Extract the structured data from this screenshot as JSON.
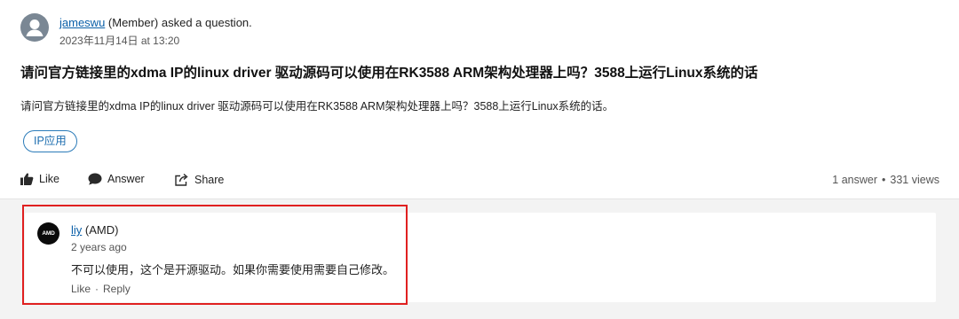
{
  "question": {
    "author": {
      "name": "jameswu",
      "suffix": " (Member) asked a question.",
      "timestamp": "2023年11月14日 at 13:20",
      "avatar_icon": "user-icon"
    },
    "title": "请问官方链接里的xdma IP的linux driver 驱动源码可以使用在RK3588 ARM架构处理器上吗？3588上运行Linux系统的话",
    "body": "请问官方链接里的xdma IP的linux driver 驱动源码可以使用在RK3588 ARM架构处理器上吗？3588上运行Linux系统的话。",
    "tag": "IP应用",
    "actions": {
      "like": "Like",
      "answer": "Answer",
      "share": "Share"
    },
    "stats": {
      "answers": "1 answer",
      "separator": "•",
      "views": "331 views"
    }
  },
  "answer": {
    "author_name": "liy",
    "author_suffix": " (AMD)",
    "avatar_text": "AMD",
    "time": "2 years ago",
    "text": "不可以使用，这个是开源驱动。如果你需要使用需要自己修改。",
    "like": "Like",
    "separator": "·",
    "reply": "Reply"
  },
  "colors": {
    "link": "#0a5fa8",
    "tag_border": "#2b7bb9",
    "highlight": "#e02020",
    "answer_bg": "#f3f3f3"
  }
}
